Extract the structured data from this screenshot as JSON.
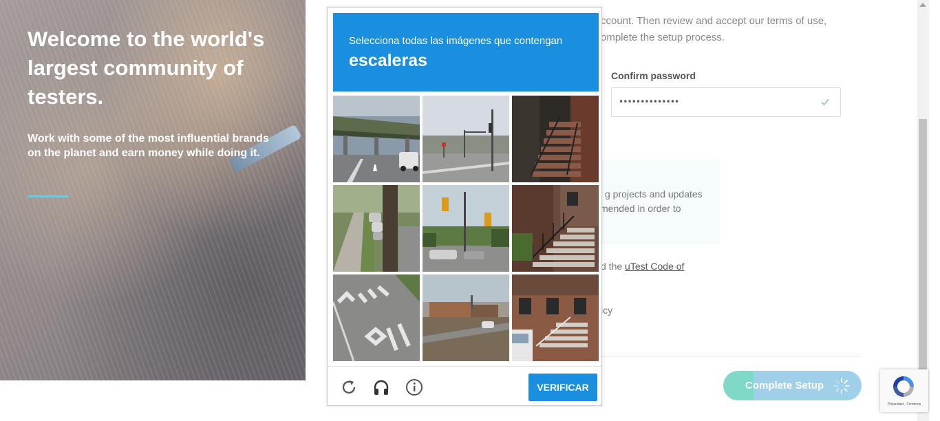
{
  "hero": {
    "title": "Welcome to the world's largest community of testers.",
    "subtitle": "Work with some of the most influential brands on the planet and earn money while doing it.",
    "accent_color": "#76c7dd"
  },
  "form": {
    "intro_line_1": "ccount. Then review and accept our terms of use,",
    "intro_line_2": "omplete the setup process.",
    "confirm_password_label": "Confirm password",
    "confirm_password_value": "••••••••••••••",
    "notice_line_1": "g projects and updates",
    "notice_line_2": "mended in order to",
    "code_prefix": "d the ",
    "code_link": "uTest Code of",
    "policy_fragment": "icy",
    "complete_button_label": "Complete Setup",
    "complete_button_colors": [
      "#7ed9c6",
      "#a0cfe9"
    ]
  },
  "captcha": {
    "instruction": "Selecciona todas las imágenes que contengan",
    "target": "escaleras",
    "header_color": "#1a8fe0",
    "tiles": [
      {
        "row": 1,
        "col": 1,
        "scene": "parking-canopy"
      },
      {
        "row": 1,
        "col": 2,
        "scene": "intersection-traffic-light"
      },
      {
        "row": 1,
        "col": 3,
        "scene": "brick-stairs"
      },
      {
        "row": 2,
        "col": 1,
        "scene": "sidewalk-tree-cars"
      },
      {
        "row": 2,
        "col": 2,
        "scene": "traffic-lights-street"
      },
      {
        "row": 2,
        "col": 3,
        "scene": "stairs-railing-house"
      },
      {
        "row": 3,
        "col": 1,
        "scene": "bus-lane-road"
      },
      {
        "row": 3,
        "col": 2,
        "scene": "road-building"
      },
      {
        "row": 3,
        "col": 3,
        "scene": "house-stairs-van"
      }
    ],
    "reload_icon": "reload-icon",
    "audio_icon": "headphones-icon",
    "info_icon": "info-icon",
    "verify_label": "VERIFICAR"
  },
  "badge": {
    "text": "Privacidad - Términos"
  }
}
